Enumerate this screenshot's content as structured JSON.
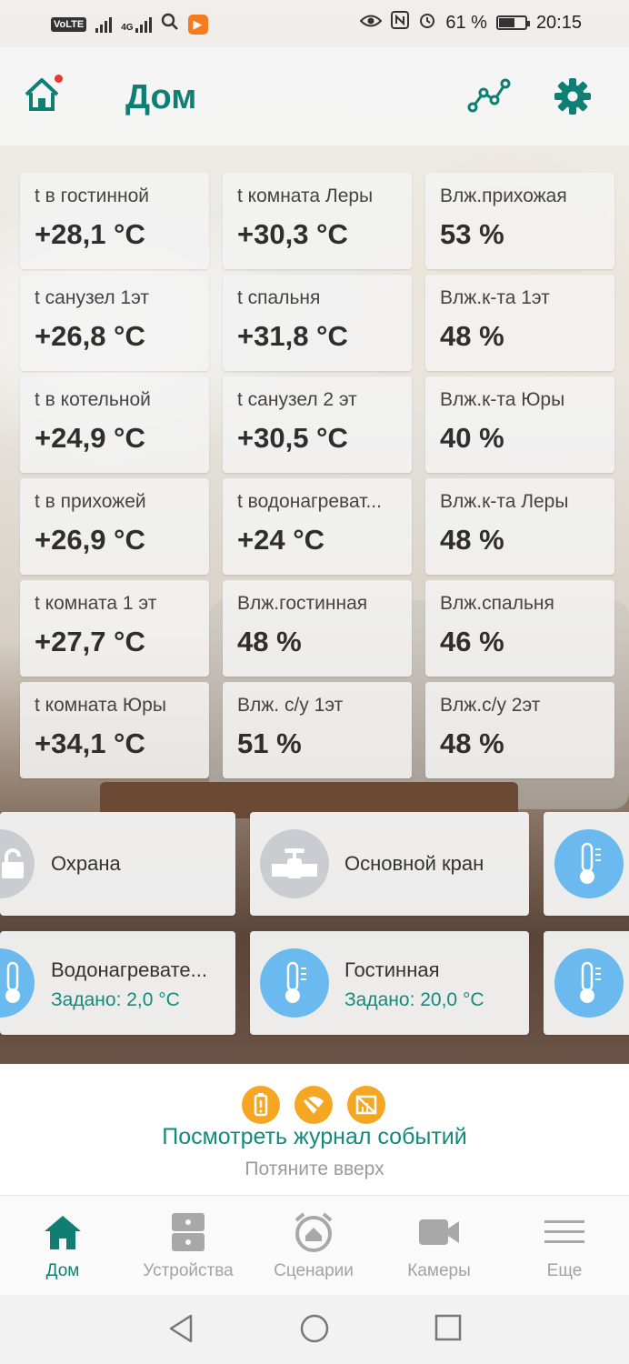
{
  "status_bar": {
    "volte": "VoLTE",
    "network": "4G",
    "battery": "61 %",
    "battery_level": 0.61,
    "time": "20:15",
    "icons": [
      "volte-icon",
      "signal-icon",
      "signal-4g-icon",
      "search-icon",
      "play-icon",
      "eye-icon",
      "nfc-icon",
      "alarm-icon",
      "battery-icon"
    ]
  },
  "header": {
    "title": "Дом",
    "icons": [
      "home-icon",
      "graph-icon",
      "gear-icon"
    ],
    "accent": "#0f7f74",
    "notification_dot": "#e53935"
  },
  "sensors": [
    {
      "label": "t в гостинной",
      "value": "+28,1 °C"
    },
    {
      "label": "t комната Леры",
      "value": "+30,3 °C"
    },
    {
      "label": "Влж.прихожая",
      "value": "53 %"
    },
    {
      "label": "t санузел 1эт",
      "value": "+26,8 °C"
    },
    {
      "label": "t спальня",
      "value": "+31,8 °C"
    },
    {
      "label": "Влж.к-та 1эт",
      "value": "48 %"
    },
    {
      "label": "t в котельной",
      "value": "+24,9 °C"
    },
    {
      "label": "t санузел 2 эт",
      "value": "+30,5 °C"
    },
    {
      "label": "Влж.к-та Юры",
      "value": "40 %"
    },
    {
      "label": "t в прихожей",
      "value": "+26,9 °C"
    },
    {
      "label": "t водонагреват...",
      "value": "+24 °C"
    },
    {
      "label": "Влж.к-та Леры",
      "value": "48 %"
    },
    {
      "label": "t комната 1 эт",
      "value": "+27,7 °C"
    },
    {
      "label": "Влж.гостинная",
      "value": "48 %"
    },
    {
      "label": "Влж.спальня",
      "value": "46 %"
    },
    {
      "label": "t комната Юры",
      "value": "+34,1 °C"
    },
    {
      "label": "Влж. с/у 1эт",
      "value": "51 %"
    },
    {
      "label": "Влж.с/у 2эт",
      "value": "48 %"
    }
  ],
  "devices": {
    "security": {
      "title": "Охрана",
      "icon": "lock-icon"
    },
    "main_valve": {
      "title": "Основной кран",
      "icon": "valve-icon"
    },
    "water_heater": {
      "title": "Водонагревате...",
      "setpoint": "Задано: 2,0 °C",
      "icon": "thermometer-icon"
    },
    "living_room": {
      "title": "Гостинная",
      "setpoint": "Задано: 20,0 °C",
      "icon": "thermometer-icon"
    }
  },
  "events": {
    "link": "Посмотреть журнал событий",
    "hint": "Потяните вверх",
    "icons": [
      "battery-warning-icon",
      "wifi-off-icon",
      "signal-off-icon"
    ],
    "color": "#f5a623"
  },
  "nav": [
    {
      "label": "Дом",
      "icon": "home-icon",
      "active": true
    },
    {
      "label": "Устройства",
      "icon": "devices-icon",
      "active": false
    },
    {
      "label": "Сценарии",
      "icon": "scenario-alarm-icon",
      "active": false
    },
    {
      "label": "Камеры",
      "icon": "camera-icon",
      "active": false
    },
    {
      "label": "Еще",
      "icon": "menu-icon",
      "active": false
    }
  ]
}
